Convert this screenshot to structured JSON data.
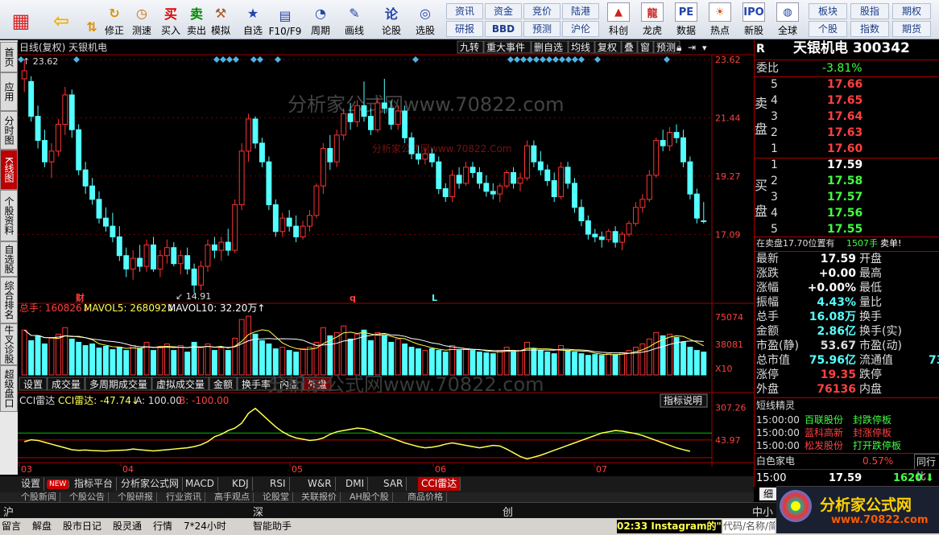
{
  "toolbar": {
    "buttons": [
      {
        "label": "",
        "icon": "grid-icon"
      },
      {
        "label": "",
        "icon": "back-icon"
      },
      {
        "label": "",
        "icon": "updown-icon"
      },
      {
        "label": "修正",
        "icon": "refresh-icon"
      },
      {
        "label": "测速",
        "icon": "clock-icon"
      },
      {
        "label": "买入",
        "icon": "buy-icon"
      },
      {
        "label": "卖出",
        "icon": "sell-icon"
      },
      {
        "label": "模拟",
        "icon": "hammer-icon"
      },
      {
        "label": "自选",
        "icon": "star-icon"
      },
      {
        "label": "F10/F9",
        "icon": "f10-icon"
      },
      {
        "label": "周期",
        "icon": "cycle-icon"
      },
      {
        "label": "画线",
        "icon": "pen-icon"
      },
      {
        "label": "论股",
        "icon": "talk-icon"
      },
      {
        "label": "选股",
        "icon": "pick-icon"
      }
    ],
    "small": [
      "资讯",
      "资金",
      "竞价",
      "陆港",
      "研报",
      "BBD",
      "预测",
      "沪伦"
    ],
    "right": [
      {
        "label": "科创",
        "icon": "chart-icon"
      },
      {
        "label": "龙虎",
        "icon": "dragon-icon"
      },
      {
        "label": "数据",
        "icon": "pe-icon"
      },
      {
        "label": "热点",
        "icon": "hot-icon"
      },
      {
        "label": "新股",
        "icon": "ipo-icon"
      },
      {
        "label": "全球",
        "icon": "globe-icon"
      }
    ],
    "far": [
      "板块",
      "股指",
      "期权",
      "个股",
      "指数",
      "期货"
    ]
  },
  "lefttabs": [
    "首页",
    "应用",
    "分时图",
    "K线图",
    "个股资料",
    "自选股",
    "综合排名",
    "牛叉诊股",
    "超级盘口"
  ],
  "chart": {
    "title": "日线(复权) 天银机电",
    "toolbar_items": [
      "九转",
      "重大事件",
      "删自选",
      "均线",
      "复权",
      "叠",
      "窗",
      "预测"
    ],
    "max_label": "23.62",
    "min_label": "14.91",
    "markers": [
      "财",
      "q",
      "L"
    ],
    "price_axis": [
      "23.62",
      "21.44",
      "19.27",
      "17.09"
    ],
    "vol_info": {
      "total": "总手: 160826",
      "mavol5": "MAVOL5: 268092",
      "mavol10": "MAVOL10: 32.20万"
    },
    "vol_axis": [
      "75074",
      "38081",
      "X10"
    ],
    "vol_tabs": [
      "设置",
      "成交量",
      "多周期成交量",
      "虚拟成交量",
      "金额",
      "换手率",
      "内盘",
      "外盘"
    ],
    "cci_info": {
      "name": "CCI雷达",
      "label": "CCI雷达: -47.74",
      "a": "A: 100.00",
      "b": "B: -100.00"
    },
    "cci_axis": [
      "307.26",
      "43.97"
    ],
    "cci_button": "指标说明",
    "date_axis": [
      "03",
      "04",
      "05",
      "06",
      "07"
    ],
    "watermark": "分析家公式网www.70822.com",
    "watermark2": "分析家公式网www.70822.Com"
  },
  "chart_data": {
    "type": "candlestick",
    "title": "日线(复权) 天银机电",
    "ylim": [
      14.91,
      23.62
    ],
    "candles": [
      {
        "o": 22.9,
        "h": 23.62,
        "l": 22.4,
        "c": 23.2
      },
      {
        "o": 22.8,
        "h": 23.0,
        "l": 21.3,
        "c": 21.5
      },
      {
        "o": 21.5,
        "h": 21.9,
        "l": 20.3,
        "c": 20.6
      },
      {
        "o": 20.6,
        "h": 21.0,
        "l": 19.6,
        "c": 19.8
      },
      {
        "o": 19.8,
        "h": 20.5,
        "l": 19.2,
        "c": 20.2
      },
      {
        "o": 20.2,
        "h": 21.4,
        "l": 20.0,
        "c": 21.2
      },
      {
        "o": 21.2,
        "h": 22.6,
        "l": 20.8,
        "c": 22.3
      },
      {
        "o": 22.3,
        "h": 22.5,
        "l": 20.7,
        "c": 21.0
      },
      {
        "o": 21.0,
        "h": 21.2,
        "l": 19.3,
        "c": 19.5
      },
      {
        "o": 19.5,
        "h": 19.8,
        "l": 18.6,
        "c": 18.9
      },
      {
        "o": 18.9,
        "h": 19.2,
        "l": 18.2,
        "c": 18.4
      },
      {
        "o": 18.4,
        "h": 18.7,
        "l": 17.5,
        "c": 17.7
      },
      {
        "o": 17.7,
        "h": 18.1,
        "l": 17.2,
        "c": 17.4
      },
      {
        "o": 17.4,
        "h": 17.9,
        "l": 16.8,
        "c": 17.0
      },
      {
        "o": 17.0,
        "h": 17.4,
        "l": 16.1,
        "c": 16.3
      },
      {
        "o": 16.3,
        "h": 16.6,
        "l": 15.5,
        "c": 15.8
      },
      {
        "o": 15.8,
        "h": 16.5,
        "l": 15.4,
        "c": 16.2
      },
      {
        "o": 16.2,
        "h": 16.7,
        "l": 15.7,
        "c": 15.9
      },
      {
        "o": 15.9,
        "h": 16.9,
        "l": 15.7,
        "c": 16.7
      },
      {
        "o": 16.7,
        "h": 17.0,
        "l": 15.7,
        "c": 15.8
      },
      {
        "o": 15.8,
        "h": 16.5,
        "l": 15.5,
        "c": 16.3
      },
      {
        "o": 16.3,
        "h": 16.9,
        "l": 16.0,
        "c": 16.6
      },
      {
        "o": 16.6,
        "h": 16.8,
        "l": 15.9,
        "c": 16.0
      },
      {
        "o": 16.0,
        "h": 16.5,
        "l": 15.6,
        "c": 16.3
      },
      {
        "o": 16.3,
        "h": 16.6,
        "l": 15.6,
        "c": 15.8
      },
      {
        "o": 15.8,
        "h": 16.0,
        "l": 14.91,
        "c": 15.2
      },
      {
        "o": 15.2,
        "h": 16.1,
        "l": 15.0,
        "c": 15.9
      },
      {
        "o": 15.9,
        "h": 16.9,
        "l": 15.7,
        "c": 16.7
      },
      {
        "o": 16.7,
        "h": 17.0,
        "l": 16.2,
        "c": 16.5
      },
      {
        "o": 16.5,
        "h": 17.0,
        "l": 16.1,
        "c": 16.8
      },
      {
        "o": 16.8,
        "h": 17.3,
        "l": 16.3,
        "c": 16.5
      },
      {
        "o": 16.5,
        "h": 18.4,
        "l": 16.4,
        "c": 18.2
      },
      {
        "o": 18.2,
        "h": 20.5,
        "l": 18.0,
        "c": 20.2
      },
      {
        "o": 20.2,
        "h": 21.6,
        "l": 19.8,
        "c": 21.4
      },
      {
        "o": 21.4,
        "h": 21.5,
        "l": 20.3,
        "c": 20.5
      },
      {
        "o": 20.5,
        "h": 20.7,
        "l": 19.6,
        "c": 19.8
      },
      {
        "o": 19.8,
        "h": 20.0,
        "l": 18.0,
        "c": 18.2
      },
      {
        "o": 18.2,
        "h": 18.4,
        "l": 17.0,
        "c": 17.2
      },
      {
        "o": 17.2,
        "h": 17.9,
        "l": 17.0,
        "c": 17.7
      },
      {
        "o": 17.7,
        "h": 18.0,
        "l": 17.2,
        "c": 17.4
      },
      {
        "o": 17.4,
        "h": 17.8,
        "l": 16.8,
        "c": 17.0
      },
      {
        "o": 17.0,
        "h": 17.6,
        "l": 16.9,
        "c": 17.4
      },
      {
        "o": 17.4,
        "h": 18.0,
        "l": 17.2,
        "c": 17.8
      },
      {
        "o": 17.8,
        "h": 19.0,
        "l": 17.7,
        "c": 18.9
      },
      {
        "o": 18.9,
        "h": 20.5,
        "l": 18.6,
        "c": 20.3
      },
      {
        "o": 20.3,
        "h": 20.8,
        "l": 19.5,
        "c": 19.8
      },
      {
        "o": 19.8,
        "h": 21.0,
        "l": 19.6,
        "c": 20.8
      },
      {
        "o": 20.8,
        "h": 21.8,
        "l": 20.6,
        "c": 21.6
      },
      {
        "o": 21.6,
        "h": 22.0,
        "l": 21.0,
        "c": 21.3
      },
      {
        "o": 21.3,
        "h": 22.1,
        "l": 21.1,
        "c": 21.9
      },
      {
        "o": 21.9,
        "h": 22.8,
        "l": 21.3,
        "c": 21.5
      },
      {
        "o": 21.5,
        "h": 21.8,
        "l": 20.8,
        "c": 21.0
      },
      {
        "o": 21.0,
        "h": 22.2,
        "l": 20.9,
        "c": 22.0
      },
      {
        "o": 22.0,
        "h": 22.9,
        "l": 21.6,
        "c": 21.8
      },
      {
        "o": 21.8,
        "h": 22.1,
        "l": 21.0,
        "c": 21.2
      },
      {
        "o": 21.2,
        "h": 21.9,
        "l": 21.0,
        "c": 21.7
      },
      {
        "o": 21.7,
        "h": 21.9,
        "l": 20.5,
        "c": 20.7
      },
      {
        "o": 20.7,
        "h": 20.9,
        "l": 19.9,
        "c": 20.1
      },
      {
        "o": 20.1,
        "h": 20.4,
        "l": 19.7,
        "c": 19.9
      },
      {
        "o": 19.9,
        "h": 20.3,
        "l": 19.7,
        "c": 20.1
      },
      {
        "o": 20.1,
        "h": 20.3,
        "l": 19.6,
        "c": 19.8
      },
      {
        "o": 19.8,
        "h": 20.0,
        "l": 18.6,
        "c": 18.8
      },
      {
        "o": 18.8,
        "h": 19.0,
        "l": 18.3,
        "c": 18.5
      },
      {
        "o": 18.5,
        "h": 19.5,
        "l": 18.3,
        "c": 19.3
      },
      {
        "o": 19.3,
        "h": 19.6,
        "l": 18.8,
        "c": 19.0
      },
      {
        "o": 19.0,
        "h": 19.8,
        "l": 18.9,
        "c": 19.6
      },
      {
        "o": 19.6,
        "h": 19.8,
        "l": 19.2,
        "c": 19.4
      },
      {
        "o": 19.4,
        "h": 19.6,
        "l": 18.8,
        "c": 19.0
      },
      {
        "o": 19.0,
        "h": 19.3,
        "l": 18.5,
        "c": 18.7
      },
      {
        "o": 18.7,
        "h": 19.0,
        "l": 18.4,
        "c": 18.6
      },
      {
        "o": 18.6,
        "h": 19.0,
        "l": 18.3,
        "c": 18.9
      },
      {
        "o": 18.9,
        "h": 19.5,
        "l": 18.8,
        "c": 19.4
      },
      {
        "o": 19.4,
        "h": 19.6,
        "l": 18.8,
        "c": 19.0
      },
      {
        "o": 19.0,
        "h": 19.4,
        "l": 18.7,
        "c": 19.2
      },
      {
        "o": 19.2,
        "h": 20.6,
        "l": 19.1,
        "c": 20.4
      },
      {
        "o": 20.4,
        "h": 20.6,
        "l": 19.6,
        "c": 19.8
      },
      {
        "o": 19.8,
        "h": 20.2,
        "l": 19.3,
        "c": 19.5
      },
      {
        "o": 19.5,
        "h": 19.7,
        "l": 18.9,
        "c": 19.1
      },
      {
        "o": 19.1,
        "h": 19.4,
        "l": 18.3,
        "c": 18.5
      },
      {
        "o": 18.5,
        "h": 19.8,
        "l": 18.4,
        "c": 19.6
      },
      {
        "o": 19.6,
        "h": 19.8,
        "l": 18.8,
        "c": 19.0
      },
      {
        "o": 19.0,
        "h": 19.2,
        "l": 17.9,
        "c": 18.1
      },
      {
        "o": 18.1,
        "h": 18.4,
        "l": 17.4,
        "c": 17.6
      },
      {
        "o": 17.6,
        "h": 17.8,
        "l": 16.9,
        "c": 17.1
      },
      {
        "o": 17.1,
        "h": 17.3,
        "l": 16.8,
        "c": 17.0
      },
      {
        "o": 17.0,
        "h": 17.2,
        "l": 16.6,
        "c": 16.9
      },
      {
        "o": 16.9,
        "h": 17.3,
        "l": 16.8,
        "c": 17.2
      },
      {
        "o": 17.2,
        "h": 17.4,
        "l": 16.6,
        "c": 16.8
      },
      {
        "o": 16.8,
        "h": 17.2,
        "l": 16.5,
        "c": 17.1
      },
      {
        "o": 17.1,
        "h": 17.6,
        "l": 17.0,
        "c": 17.5
      },
      {
        "o": 17.5,
        "h": 18.3,
        "l": 17.4,
        "c": 18.1
      },
      {
        "o": 18.1,
        "h": 18.6,
        "l": 17.9,
        "c": 18.4
      },
      {
        "o": 18.4,
        "h": 19.5,
        "l": 18.3,
        "c": 19.3
      },
      {
        "o": 19.3,
        "h": 20.7,
        "l": 19.2,
        "c": 20.6
      },
      {
        "o": 20.6,
        "h": 21.0,
        "l": 20.2,
        "c": 20.4
      },
      {
        "o": 20.4,
        "h": 21.1,
        "l": 20.2,
        "c": 20.9
      },
      {
        "o": 20.9,
        "h": 21.2,
        "l": 20.5,
        "c": 20.7
      },
      {
        "o": 20.7,
        "h": 21.0,
        "l": 19.6,
        "c": 19.8
      },
      {
        "o": 19.8,
        "h": 20.0,
        "l": 18.4,
        "c": 18.6
      },
      {
        "o": 18.6,
        "h": 18.8,
        "l": 17.5,
        "c": 17.7
      },
      {
        "o": 17.6,
        "h": 18.3,
        "l": 17.5,
        "c": 17.59
      }
    ],
    "volume": [
      55,
      42,
      48,
      38,
      45,
      50,
      58,
      44,
      40,
      36,
      38,
      33,
      35,
      31,
      34,
      30,
      36,
      32,
      40,
      30,
      35,
      38,
      30,
      36,
      28,
      40,
      34,
      38,
      30,
      33,
      30,
      45,
      68,
      72,
      50,
      42,
      38,
      32,
      34,
      30,
      28,
      32,
      34,
      40,
      58,
      48,
      52,
      60,
      44,
      50,
      55,
      42,
      52,
      48,
      40,
      44,
      38,
      34,
      32,
      30,
      32,
      30,
      28,
      36,
      30,
      32,
      30,
      28,
      27,
      26,
      30,
      34,
      28,
      30,
      40,
      32,
      30,
      28,
      26,
      36,
      30,
      28,
      26,
      24,
      25,
      24,
      26,
      25,
      27,
      30,
      34,
      38,
      44,
      52,
      48,
      50,
      46,
      40,
      34,
      30,
      28
    ],
    "cci": [
      30,
      45,
      40,
      25,
      10,
      -5,
      -20,
      -35,
      -40,
      -38,
      -42,
      -44,
      -46,
      -42,
      -40,
      -38,
      -30,
      -35,
      -40,
      -45,
      -40,
      -35,
      -30,
      -25,
      -20,
      -10,
      5,
      30,
      70,
      90,
      120,
      140,
      180,
      260,
      300,
      250,
      200,
      150,
      110,
      80,
      60,
      50,
      40,
      45,
      60,
      90,
      110,
      120,
      130,
      140,
      135,
      120,
      100,
      80,
      60,
      40,
      20,
      5,
      -10,
      -20,
      -15,
      -5,
      10,
      20,
      10,
      0,
      -10,
      -20,
      -10,
      0,
      -5,
      -30,
      -60,
      -90,
      -110,
      -95,
      -80,
      -60,
      -40,
      -20,
      0,
      20,
      40,
      60,
      80,
      100,
      110,
      120,
      115,
      105,
      95,
      80,
      60,
      40,
      20,
      0,
      -20,
      -35,
      -47.74
    ]
  },
  "quote": {
    "code_name": "天银机电 300342",
    "r_label": "R",
    "wb_label": "委比",
    "wb_value": "-3.81%",
    "sell_label": "卖",
    "sell_label2": "盘",
    "buy_label": "买",
    "buy_label2": "盘",
    "sells": [
      {
        "lvl": "5",
        "price": "17.66"
      },
      {
        "lvl": "4",
        "price": "17.65"
      },
      {
        "lvl": "3",
        "price": "17.64"
      },
      {
        "lvl": "2",
        "price": "17.63"
      },
      {
        "lvl": "1",
        "price": "17.60"
      }
    ],
    "buys": [
      {
        "lvl": "1",
        "price": "17.59"
      },
      {
        "lvl": "2",
        "price": "17.58"
      },
      {
        "lvl": "3",
        "price": "17.57"
      },
      {
        "lvl": "4",
        "price": "17.56"
      },
      {
        "lvl": "5",
        "price": "17.55"
      }
    ],
    "notice_a": "在卖盘17.70位置有",
    "notice_b": "1507手",
    "notice_c": "卖单!",
    "stats": [
      {
        "k": "最新",
        "v": "17.59",
        "k2": "开盘",
        "v2": ""
      },
      {
        "k": "涨跌",
        "v": "+0.00",
        "k2": "最高",
        "v2": ""
      },
      {
        "k": "涨幅",
        "v": "+0.00%",
        "k2": "最低",
        "v2": ""
      },
      {
        "k": "振幅",
        "v": "4.43%",
        "k2": "量比",
        "v2": ""
      },
      {
        "k": "总手",
        "v": "16.08万",
        "k2": "换手",
        "v2": ""
      },
      {
        "k": "金额",
        "v": "2.86亿",
        "k2": "换手(实)",
        "v2": ""
      },
      {
        "k": "市盈(静)",
        "v": "53.67",
        "k2": "市盈(动)",
        "v2": ""
      },
      {
        "k": "总市值",
        "v": "75.96亿",
        "k2": "流通值",
        "v2": "73"
      },
      {
        "k": "涨停",
        "v": "19.35",
        "k2": "跌停",
        "v2": ""
      },
      {
        "k": "外盘",
        "v": "76136",
        "k2": "内盘",
        "v2": ""
      }
    ],
    "short_title": "短线精灵",
    "short": [
      {
        "t": "15:00:00",
        "n": "百联股份",
        "e": "封跌停板"
      },
      {
        "t": "15:00:00",
        "n": "蓝科高新",
        "e": "封涨停板"
      },
      {
        "t": "15:00:00",
        "n": "松发股份",
        "e": "打开跌停板"
      }
    ],
    "sector_name": "白色家电",
    "sector_pct": "0.57%",
    "sector_btn": "同行比",
    "trade": {
      "t": "15:00",
      "p": "17.59",
      "v": "1620"
    },
    "detail_tab": "细"
  },
  "bottom": {
    "tabs": [
      "设置",
      "NEW",
      "指标平台",
      "分析家公式网",
      "MACD",
      "KDJ",
      "RSI",
      "W&R",
      "DMI",
      "SAR",
      "CCI雷达"
    ],
    "row2": [
      "个股新闻",
      "个股公告",
      "个股研报",
      "行业资讯",
      "高手观点",
      "论股堂",
      "关联报价",
      "AH股个股",
      "商品价格"
    ],
    "market": [
      "沪",
      "深",
      "创"
    ],
    "market2": "中小",
    "status": [
      "留言",
      "解盘",
      "股市日记",
      "股灵通",
      "行情",
      "7*24小时",
      "智能助手"
    ],
    "ticker": "02:33 Instagram的\"i",
    "search_placeholder": "代码/名称/简",
    "logo": "分析家公式网",
    "logo_url": "www.70822.com"
  },
  "colors": {
    "up": "#ff3232",
    "down": "#54ffff",
    "bg": "#000000",
    "accent": "#b00000"
  }
}
